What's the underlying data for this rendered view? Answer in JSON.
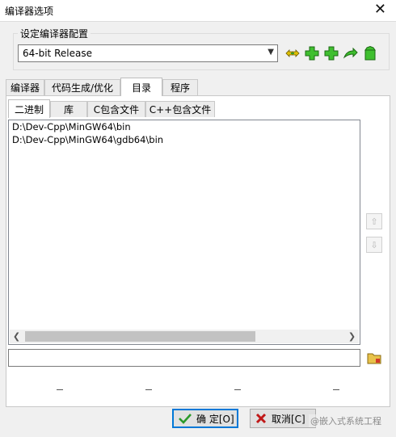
{
  "window": {
    "title": "编译器选项",
    "close_glyph": "✕"
  },
  "config_group": {
    "label": "设定编译器配置",
    "selected": "64-bit Release",
    "toolbar_icons": [
      "rename-icon",
      "add-icon",
      "add-copy-icon",
      "export-icon",
      "delete-icon"
    ]
  },
  "main_tabs": [
    "编译器",
    "代码生成/优化",
    "目录",
    "程序"
  ],
  "main_tab_active": "目录",
  "sub_tabs": [
    "二进制",
    "库",
    "C包含文件",
    "C++包含文件"
  ],
  "sub_tab_active": "二进制",
  "dir_list": [
    "D:\\Dev-Cpp\\MinGW64\\bin",
    "D:\\Dev-Cpp\\MinGW64\\gdb64\\bin"
  ],
  "path_input": {
    "value": ""
  },
  "buttons": {
    "ok": "确 定[O]",
    "cancel": "取消[C]"
  },
  "watermark": "@嵌入式系统工程"
}
